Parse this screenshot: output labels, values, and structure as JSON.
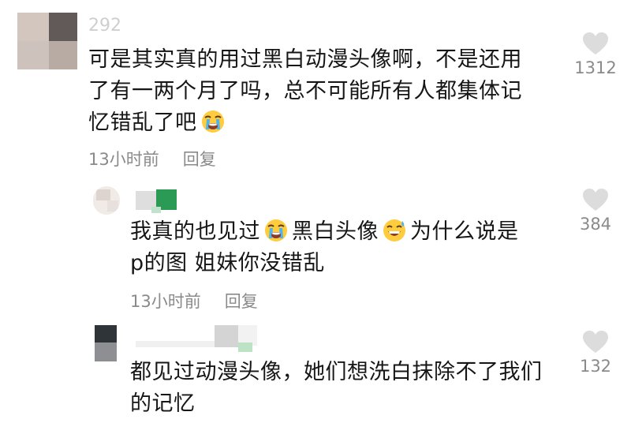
{
  "comments": [
    {
      "nickname": "292",
      "text_lines": [
        "可是其实真的用过黑白动漫头像啊，不是还用",
        "了有一两个月了吗，总不可能所有人都集体记",
        "忆错乱了吧"
      ],
      "emoji_after_text": "loudly-crying-face",
      "time": "13小时前",
      "reply_label": "回复",
      "likes": "1312"
    },
    {
      "text_line1_a": "我真的也见过",
      "text_line1_b": "黑白头像",
      "text_line1_c": "为什么说是",
      "text_line2": "p的图 姐妹你没错乱",
      "emoji1": "loudly-crying-face",
      "emoji2": "grinning-sweat-face",
      "time": "13小时前",
      "reply_label": "回复",
      "likes": "384"
    },
    {
      "text_lines": [
        "都见过动漫头像，她们想洗白抹除不了我们",
        "的记忆"
      ],
      "likes": "132"
    }
  ],
  "colors": {
    "heart": "#dcdcdc",
    "meta_text": "#8a8a8a",
    "body_text": "#161616"
  }
}
